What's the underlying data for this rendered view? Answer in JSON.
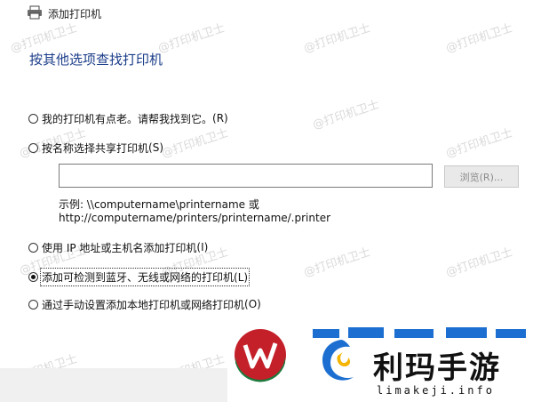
{
  "window": {
    "title": "添加打印机"
  },
  "heading": "按其他选项查找打印机",
  "options": [
    {
      "label": "我的打印机有点老。请帮我找到它。",
      "key": "(R)",
      "checked": false
    },
    {
      "label": "按名称选择共享打印机",
      "key": "(S)",
      "checked": false
    },
    {
      "label": "使用 IP 地址或主机名添加打印机",
      "key": "(I)",
      "checked": false
    },
    {
      "label": "添加可检测到蓝牙、无线或网络的打印机",
      "key": "(L)",
      "checked": true
    },
    {
      "label": "通过手动设置添加本地打印机或网络打印机",
      "key": "(O)",
      "checked": false
    }
  ],
  "share": {
    "input_value": "",
    "browse_label": "浏览(R)...",
    "example_line1": "示例: \\\\computername\\printername 或",
    "example_line2": "http://computername/printers/printername/.printer"
  },
  "watermark": "@打印机卫士",
  "logo": {
    "brand": "利玛手游",
    "domain": "limakeji.info"
  },
  "colors": {
    "heading": "#1c3e8a",
    "logo_red": "#c4202a",
    "logo_green": "#1b7a3c",
    "logo_blue": "#1c6fd1"
  }
}
